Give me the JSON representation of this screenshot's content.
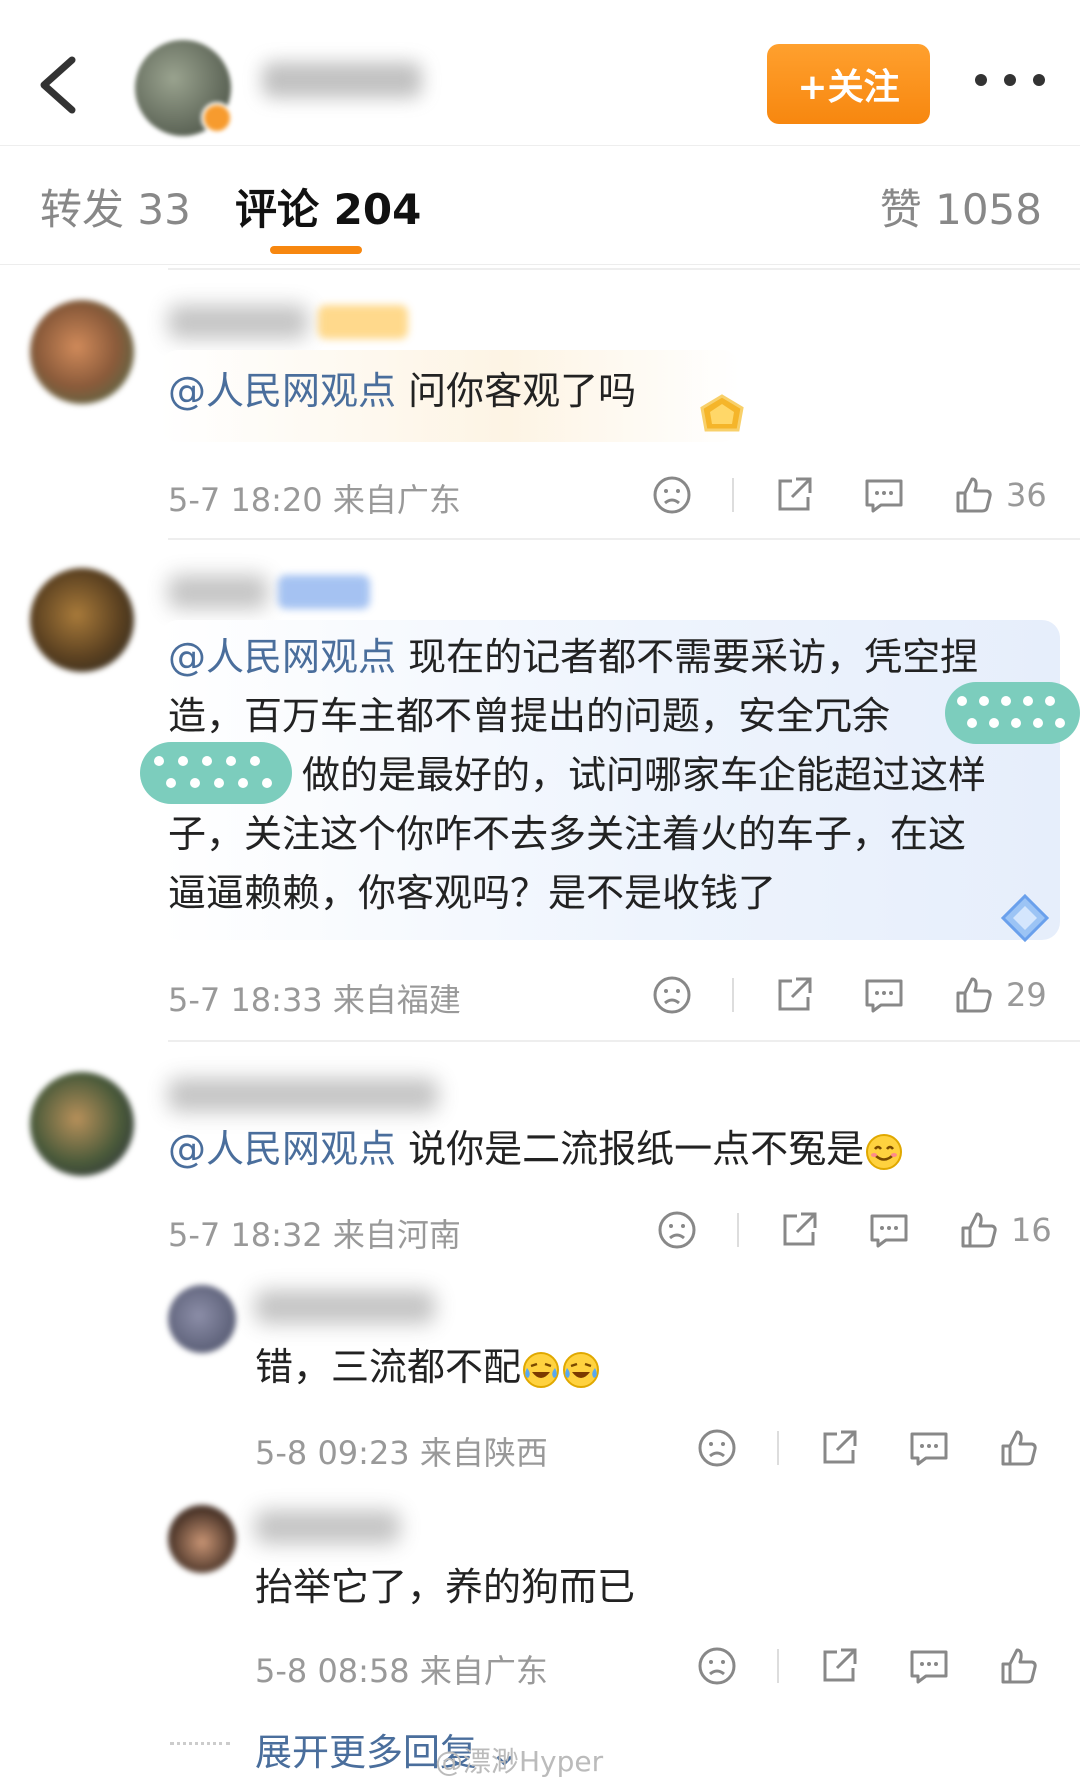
{
  "header": {
    "follow_label": "+关注",
    "icons": [
      "back-icon",
      "more-icon"
    ]
  },
  "tabs": {
    "repost": "转发 33",
    "comments": "评论 204",
    "likes": "赞 1058"
  },
  "comments": [
    {
      "mention": "@人民网观点",
      "text": " 问你客观了吗",
      "time_location": "5-7 18:20  来自广东",
      "like_count": "36",
      "replies": []
    },
    {
      "mention": "@人民网观点",
      "text_line1": " 现在的记者都不需要采访，凭空捏",
      "text_line2": "造，百万车主都不曾提出的问题，安全冗余",
      "text_line3": "做的是最好的，试问哪家车企能超过这样",
      "text_line4": "子，关注这个你咋不去多关注着火的车子，在这",
      "text_line5": "逼逼赖赖，你客观吗？是不是收钱了",
      "time_location": "5-7 18:33  来自福建",
      "like_count": "29"
    },
    {
      "mention": "@人民网观点",
      "text": "  说你是二流报纸一点不冤是",
      "time_location": "5-7 18:32  来自河南",
      "like_count": "16",
      "replies": [
        {
          "text": "错，三流都不配",
          "time_location": "5-8 09:23  来自陕西"
        },
        {
          "text": "抬举它了，养的狗而已",
          "time_location": "5-8 08:58  来自广东"
        }
      ],
      "more_replies_label": "展开更多回复 ⌄"
    }
  ],
  "watermark": "@漂渺Hyper",
  "colors": {
    "accent_orange": "#f7870f",
    "mention_blue": "#4a6e9c",
    "meta_gray": "#999999"
  }
}
